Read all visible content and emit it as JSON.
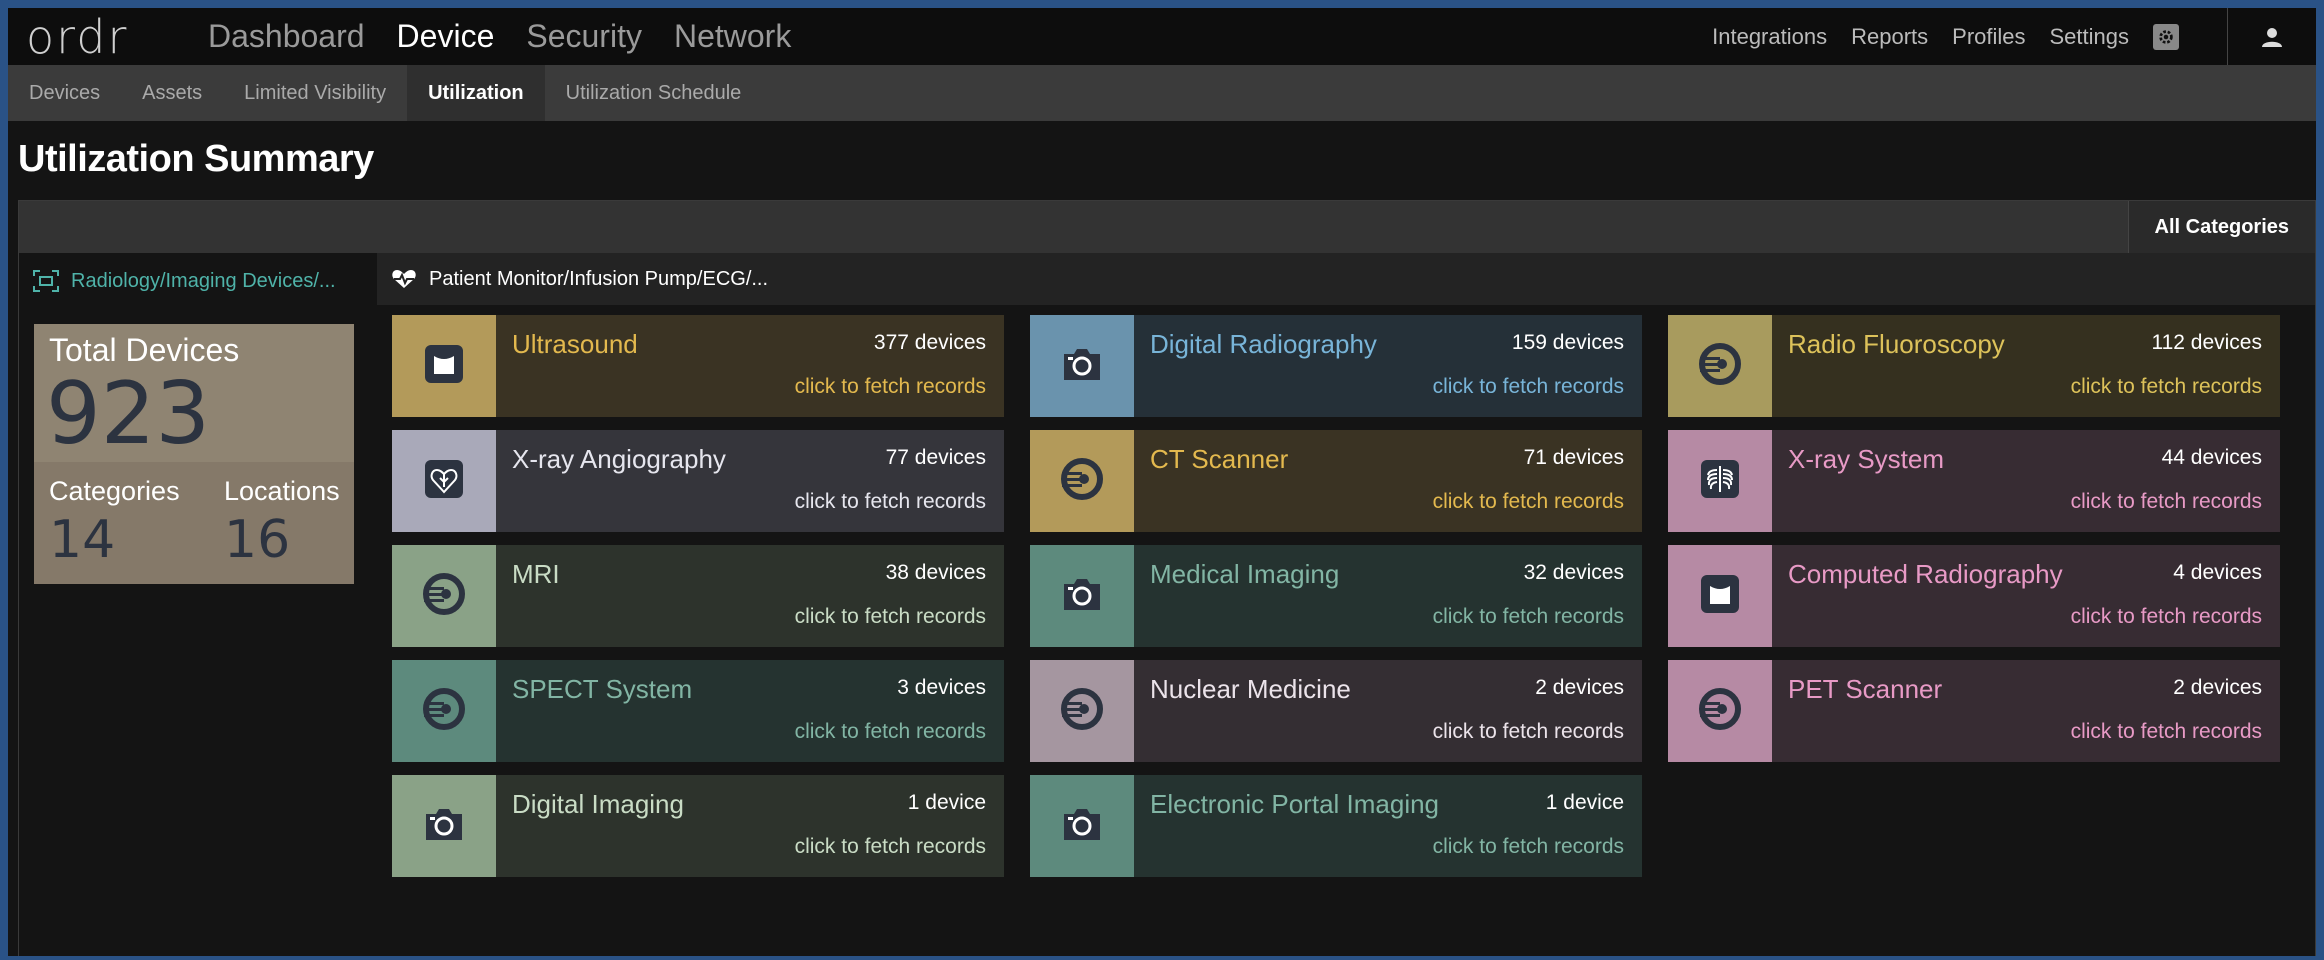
{
  "app": {
    "logo": "ordr"
  },
  "nav": {
    "main": [
      "Dashboard",
      "Device",
      "Security",
      "Network"
    ],
    "active_main": "Device",
    "right": [
      "Integrations",
      "Reports",
      "Profiles",
      "Settings"
    ]
  },
  "subnav": {
    "items": [
      "Devices",
      "Assets",
      "Limited Visibility",
      "Utilization",
      "Utilization Schedule"
    ],
    "active": "Utilization"
  },
  "page": {
    "title": "Utilization Summary"
  },
  "panel": {
    "all_categories": "All Categories",
    "tabs": [
      "Radiology/Imaging Devices/...",
      "Patient Monitor/Infusion Pump/ECG/..."
    ],
    "active_tab": 0
  },
  "summary": {
    "total_label": "Total Devices",
    "total_value": "923",
    "categories_label": "Categories",
    "categories_value": "14",
    "locations_label": "Locations",
    "locations_value": "16"
  },
  "fetch_label": "click to fetch records",
  "cards": [
    {
      "name": "Ultrasound",
      "count": "377 devices",
      "icon": "ultrasound-icon",
      "theme": "gold"
    },
    {
      "name": "Digital Radiography",
      "count": "159 devices",
      "icon": "camera-icon",
      "theme": "blue"
    },
    {
      "name": "Radio Fluoroscopy",
      "count": "112 devices",
      "icon": "scanner-icon",
      "theme": "olive"
    },
    {
      "name": "X-ray Angiography",
      "count": "77 devices",
      "icon": "heart-icon",
      "theme": "lavender"
    },
    {
      "name": "CT Scanner",
      "count": "71 devices",
      "icon": "scanner-icon",
      "theme": "gold"
    },
    {
      "name": "X-ray System",
      "count": "44 devices",
      "icon": "ribcage-icon",
      "theme": "pink"
    },
    {
      "name": "MRI",
      "count": "38 devices",
      "icon": "scanner-icon",
      "theme": "sage"
    },
    {
      "name": "Medical Imaging",
      "count": "32 devices",
      "icon": "camera-icon",
      "theme": "teal"
    },
    {
      "name": "Computed Radiography",
      "count": "4 devices",
      "icon": "ultrasound-icon",
      "theme": "pink"
    },
    {
      "name": "SPECT System",
      "count": "3 devices",
      "icon": "scanner-icon",
      "theme": "teal"
    },
    {
      "name": "Nuclear Medicine",
      "count": "2 devices",
      "icon": "scanner-icon",
      "theme": "mauve"
    },
    {
      "name": "PET Scanner",
      "count": "2 devices",
      "icon": "scanner-icon",
      "theme": "pink"
    },
    {
      "name": "Digital Imaging",
      "count": "1 device",
      "icon": "camera-icon",
      "theme": "sage"
    },
    {
      "name": "Electronic Portal Imaging",
      "count": "1 device",
      "icon": "camera-icon",
      "theme": "teal"
    }
  ],
  "themes": {
    "gold": {
      "icon_bg": "#b39a5a",
      "body_bg": "#3a3323",
      "text": "#e3b94e",
      "link": "#e3b94e"
    },
    "blue": {
      "icon_bg": "#6a93ad",
      "body_bg": "#253038",
      "text": "#78b4d8",
      "link": "#78b4d8"
    },
    "olive": {
      "icon_bg": "#a89b5e",
      "body_bg": "#35301f",
      "text": "#ddc25a",
      "link": "#ddc25a"
    },
    "lavender": {
      "icon_bg": "#a9a9b9",
      "body_bg": "#35353b",
      "text": "#e6e6ee",
      "link": "#e6e6ee"
    },
    "pink": {
      "icon_bg": "#b68aa4",
      "body_bg": "#372c33",
      "text": "#e89ac6",
      "link": "#e89ac6"
    },
    "sage": {
      "icon_bg": "#8aa287",
      "body_bg": "#2d332c",
      "text": "#c9dcc5",
      "link": "#c9dcc5"
    },
    "teal": {
      "icon_bg": "#5d8a7d",
      "body_bg": "#253330",
      "text": "#82b5a4",
      "link": "#82b5a4"
    },
    "mauve": {
      "icon_bg": "#a596a0",
      "body_bg": "#342e33",
      "text": "#ebe3ea",
      "link": "#ebe3ea"
    }
  }
}
